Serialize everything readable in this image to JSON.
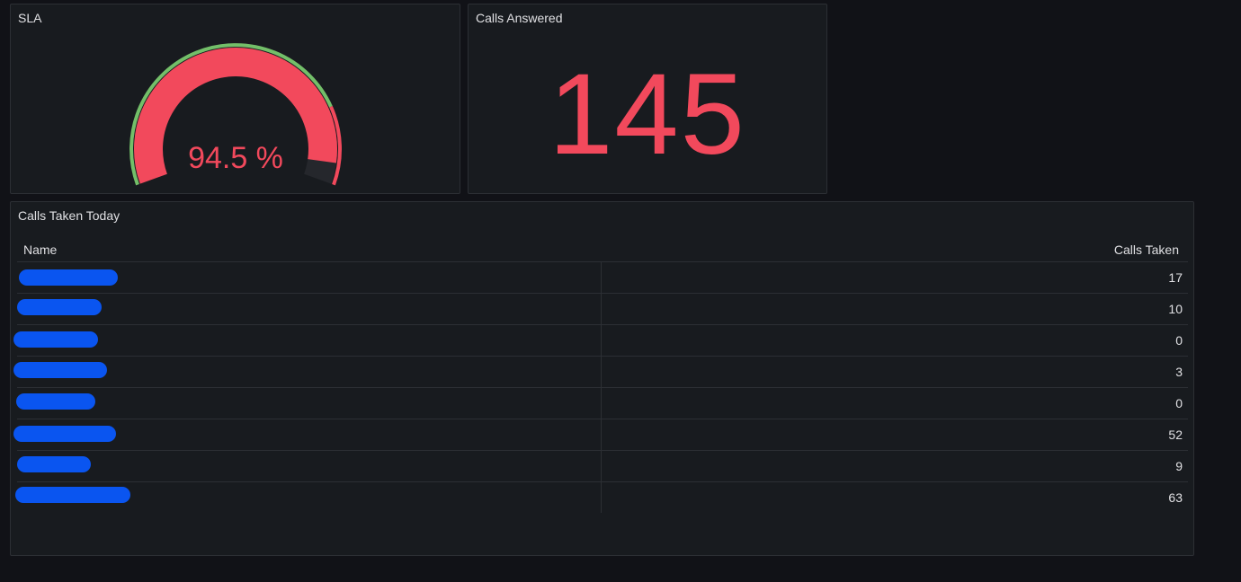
{
  "colors": {
    "background": "#111217",
    "panel": "#181b1f",
    "accent_red": "#f2495c",
    "threshold_green": "#73bf69",
    "redaction_blue": "#0a55f0"
  },
  "sla_panel": {
    "title": "SLA",
    "value_text": "94.5 %",
    "value": 94.5
  },
  "calls_answered_panel": {
    "title": "Calls Answered",
    "value": "145"
  },
  "calls_table": {
    "title": "Calls Taken Today",
    "columns": [
      "Name",
      "Calls Taken"
    ],
    "rows": [
      {
        "name": "",
        "calls": "17"
      },
      {
        "name": "",
        "calls": "10"
      },
      {
        "name": "",
        "calls": "0"
      },
      {
        "name": "",
        "calls": "3"
      },
      {
        "name": "",
        "calls": "0"
      },
      {
        "name": "",
        "calls": "52"
      },
      {
        "name": "",
        "calls": "9"
      },
      {
        "name": "",
        "calls": "63"
      }
    ]
  }
}
